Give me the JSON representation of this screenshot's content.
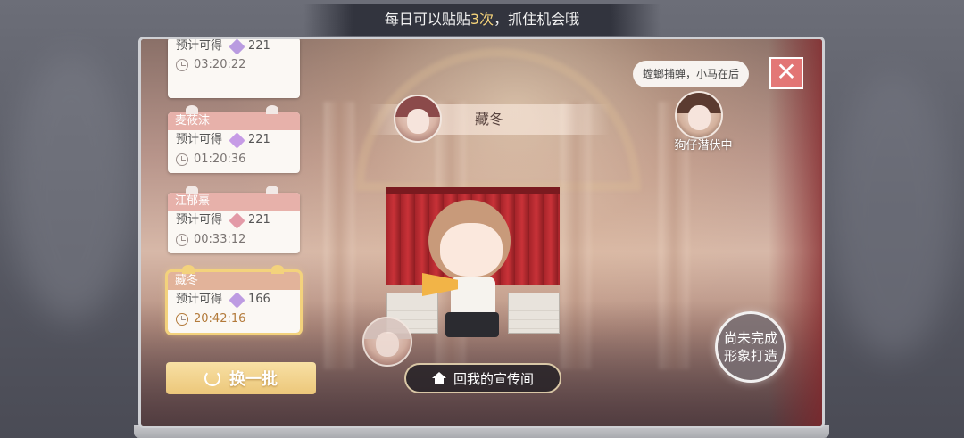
{
  "banner": {
    "prefix": "每日可以贴贴",
    "count": "3次",
    "suffix": "，抓住机会哦"
  },
  "list": [
    {
      "name": "",
      "expect_label": "预计可得",
      "points": "221",
      "time": "03:20:22",
      "header_color": "#e6a9a6",
      "gem_color": "#b99be0"
    },
    {
      "name": "麦莜沫",
      "expect_label": "预计可得",
      "points": "221",
      "time": "01:20:36",
      "header_color": "#e7b1aa",
      "gem_color": "#c69be6"
    },
    {
      "name": "江郁熹",
      "expect_label": "预计可得",
      "points": "221",
      "time": "00:33:12",
      "header_color": "#e7b1aa",
      "gem_color": "#e39aa7"
    },
    {
      "name": "藏冬",
      "expect_label": "预计可得",
      "points": "166",
      "time": "20:42:16",
      "header_color": "#e2b39a",
      "gem_color": "#bd9be2"
    }
  ],
  "swap_button": "换一批",
  "current": {
    "name": "藏冬"
  },
  "rival": {
    "bubble": "螳螂捕蝉，小马在后",
    "label": "狗仔潜伏中"
  },
  "home_button": "回我的宣传间",
  "style_button": {
    "line1": "尚未完成",
    "line2": "形象打造"
  },
  "close_icon": "close-icon"
}
